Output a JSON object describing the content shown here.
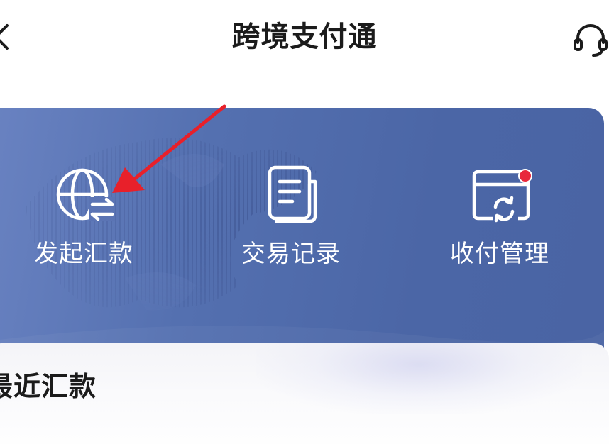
{
  "header": {
    "title": "跨境支付通",
    "back_icon": "chevron-left-icon",
    "support_icon": "headset-icon"
  },
  "banner": {
    "actions": [
      {
        "label": "发起汇款",
        "icon": "globe-transfer-icon"
      },
      {
        "label": "交易记录",
        "icon": "document-icon"
      },
      {
        "label": "收付管理",
        "icon": "card-sync-icon",
        "has_badge": true
      }
    ]
  },
  "recent": {
    "title": "最近汇款"
  },
  "colors": {
    "banner_start": "#6a83c2",
    "banner_end": "#4a64a4",
    "badge": "#e8283c",
    "annotation_arrow": "#e8202a",
    "title_text": "#1b1b1b"
  }
}
